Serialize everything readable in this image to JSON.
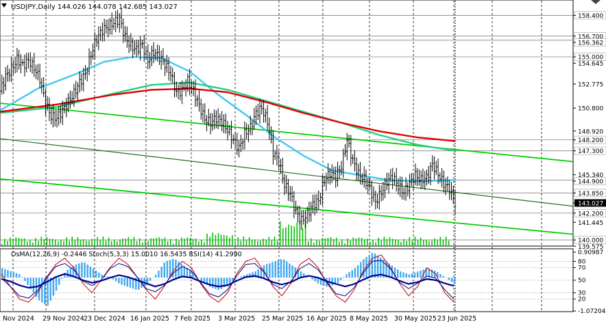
{
  "header": {
    "symbol_line": "USDJPY,Daily  144.026 144.078 142.685 143.027",
    "indicator_line": "OsMA(12,26,9) -0.2446  Stoch(5,3,3) 15.0010 16.5435  RSI(14) 41.2990"
  },
  "colors": {
    "price_bars": "#000000",
    "ma_fast": "#40c8f0",
    "ma_mid": "#20d080",
    "ma_slow": "#e00000",
    "channel": "#00d000",
    "channel_dark": "#207020",
    "volume": "#00c000",
    "osma_hist": "#40a8f0",
    "macd_line": "#00008b",
    "stoch_main": "#c00000",
    "stoch_signal": "#000080",
    "level_line": "#808080",
    "current_price_bg": "#000000"
  },
  "chart_data": [
    {
      "type": "candlestick",
      "title": "USDJPY,Daily  144.026 144.078 142.685 143.027",
      "y_ticks": [
        "158.400",
        "156.700",
        "156.362",
        "155.000",
        "154.645",
        "152.775",
        "150.800",
        "148.920",
        "148.200",
        "147.300",
        "145.340",
        "144.900",
        "143.850",
        "143.027",
        "142.200",
        "141.445",
        "140.000",
        "139.575"
      ],
      "ylim": [
        139.5,
        159.6
      ],
      "price_levels": [
        158.4,
        156.7,
        156.362,
        155.0,
        148.2,
        147.3,
        144.9,
        143.85,
        142.2,
        140.0
      ],
      "current_price": 143.027,
      "x_labels": [
        "7 Nov 2024",
        "29 Nov 2024",
        "23 Dec 2024",
        "16 Jan 2025",
        "7 Feb 2025",
        "3 Mar 2025",
        "25 Mar 2025",
        "16 Apr 2025",
        "8 May 2025",
        "30 May 2025",
        "23 Jun 2025"
      ],
      "close_path": [
        [
          0,
          152.2
        ],
        [
          3,
          153.4
        ],
        [
          6,
          154.0
        ],
        [
          9,
          154.8
        ],
        [
          12,
          154.3
        ],
        [
          15,
          154.7
        ],
        [
          18,
          154.1
        ],
        [
          21,
          153.2
        ],
        [
          24,
          151.2
        ],
        [
          27,
          150.1
        ],
        [
          30,
          150.0
        ],
        [
          33,
          150.6
        ],
        [
          36,
          151.3
        ],
        [
          39,
          152.0
        ],
        [
          42,
          152.9
        ],
        [
          45,
          153.6
        ],
        [
          48,
          155.2
        ],
        [
          51,
          156.5
        ],
        [
          54,
          157.2
        ],
        [
          57,
          157.5
        ],
        [
          60,
          157.8
        ],
        [
          63,
          158.1
        ],
        [
          66,
          156.6
        ],
        [
          69,
          155.9
        ],
        [
          72,
          155.6
        ],
        [
          75,
          156.0
        ],
        [
          78,
          154.7
        ],
        [
          81,
          155.4
        ],
        [
          84,
          155.0
        ],
        [
          87,
          154.4
        ],
        [
          90,
          153.6
        ],
        [
          93,
          152.1
        ],
        [
          96,
          152.2
        ],
        [
          99,
          153.0
        ],
        [
          102,
          152.2
        ],
        [
          105,
          151.0
        ],
        [
          108,
          149.9
        ],
        [
          111,
          149.6
        ],
        [
          114,
          150.0
        ],
        [
          117,
          149.7
        ],
        [
          120,
          149.0
        ],
        [
          123,
          148.2
        ],
        [
          126,
          147.5
        ],
        [
          129,
          148.7
        ],
        [
          132,
          149.2
        ],
        [
          135,
          150.4
        ],
        [
          138,
          150.8
        ],
        [
          141,
          149.7
        ],
        [
          144,
          147.2
        ],
        [
          147,
          146.4
        ],
        [
          150,
          144.5
        ],
        [
          153,
          143.8
        ],
        [
          156,
          142.3
        ],
        [
          159,
          141.6
        ],
        [
          162,
          142.1
        ],
        [
          165,
          142.9
        ],
        [
          168,
          143.2
        ],
        [
          171,
          144.9
        ],
        [
          174,
          145.5
        ],
        [
          177,
          145.2
        ],
        [
          180,
          146.0
        ],
        [
          183,
          148.2
        ],
        [
          186,
          146.5
        ],
        [
          189,
          145.4
        ],
        [
          192,
          145.0
        ],
        [
          195,
          144.2
        ],
        [
          198,
          143.1
        ],
        [
          201,
          143.9
        ],
        [
          204,
          144.8
        ],
        [
          207,
          145.2
        ],
        [
          210,
          144.4
        ],
        [
          213,
          143.9
        ],
        [
          216,
          144.6
        ],
        [
          219,
          145.3
        ],
        [
          222,
          144.9
        ],
        [
          225,
          145.1
        ],
        [
          228,
          146.2
        ],
        [
          231,
          145.4
        ],
        [
          234,
          144.6
        ],
        [
          237,
          144.2
        ],
        [
          240,
          143.0
        ]
      ],
      "moving_averages": [
        {
          "name": "ma_fast",
          "values": [
            [
              0,
              150.6
            ],
            [
              20,
              152.4
            ],
            [
              40,
              153.6
            ],
            [
              55,
              154.6
            ],
            [
              70,
              155.0
            ],
            [
              85,
              154.9
            ],
            [
              100,
              153.8
            ],
            [
              115,
              151.9
            ],
            [
              130,
              150.2
            ],
            [
              145,
              148.4
            ],
            [
              160,
              146.9
            ],
            [
              175,
              145.7
            ],
            [
              190,
              145.3
            ],
            [
              205,
              144.9
            ],
            [
              220,
              144.8
            ],
            [
              240,
              144.9
            ]
          ]
        },
        {
          "name": "ma_mid",
          "values": [
            [
              0,
              150.4
            ],
            [
              30,
              150.9
            ],
            [
              60,
              152.0
            ],
            [
              80,
              152.7
            ],
            [
              100,
              152.9
            ],
            [
              120,
              152.3
            ],
            [
              140,
              151.4
            ],
            [
              160,
              150.5
            ],
            [
              180,
              149.6
            ],
            [
              200,
              148.6
            ],
            [
              220,
              147.8
            ],
            [
              240,
              147.3
            ]
          ]
        },
        {
          "name": "ma_slow",
          "values": [
            [
              0,
              150.5
            ],
            [
              30,
              151.1
            ],
            [
              60,
              151.9
            ],
            [
              80,
              152.3
            ],
            [
              100,
              152.4
            ],
            [
              120,
              152.1
            ],
            [
              140,
              151.3
            ],
            [
              160,
              150.4
            ],
            [
              180,
              149.6
            ],
            [
              200,
              148.9
            ],
            [
              220,
              148.4
            ],
            [
              240,
              148.1
            ]
          ]
        }
      ],
      "channel_lines": [
        {
          "name": "channel_upper",
          "values": [
            [
              0,
              151.2
            ],
            [
              240,
              147.4
            ]
          ]
        },
        {
          "name": "channel_middle",
          "values": [
            [
              0,
              148.3
            ],
            [
              240,
              143.9
            ]
          ]
        },
        {
          "name": "channel_lower",
          "values": [
            [
              0,
              145.0
            ],
            [
              240,
              141.4
            ]
          ]
        }
      ]
    },
    {
      "type": "oscillator",
      "title": "OsMA(12,26,9) -0.2446  Stoch(5,3,3) 15.0010 16.5435  RSI(14) 41.2990",
      "y_ticks": [
        "0.90987",
        "80",
        "70",
        "50",
        "30",
        "20",
        "-1.07204"
      ],
      "ylim": [
        -1.07204,
        0.90987
      ],
      "levels": [
        80,
        70,
        50,
        30,
        20
      ],
      "osma": [
        0.3,
        0.2,
        0.1,
        -0.3,
        -0.7,
        -0.9,
        -0.4,
        0.2,
        0.4,
        0.5,
        0.3,
        0.1,
        0.0,
        -0.2,
        -0.3,
        -0.4,
        -0.2,
        0.1,
        0.5,
        0.6,
        0.4,
        0.2,
        -0.1,
        -0.3,
        -0.4,
        -0.2,
        0.0,
        0.1,
        0.2,
        0.4,
        0.5,
        0.6,
        0.4,
        0.2,
        0.0,
        -0.2,
        -0.3,
        -0.2,
        0.1,
        0.3,
        0.6,
        0.8,
        0.6,
        0.4,
        0.2,
        0.1,
        0.2,
        0.3,
        0.2,
        0.0,
        -0.2
      ],
      "stoch": [
        60,
        40,
        20,
        15,
        30,
        55,
        75,
        85,
        70,
        45,
        30,
        50,
        70,
        85,
        75,
        55,
        35,
        20,
        40,
        65,
        80,
        70,
        45,
        25,
        15,
        30,
        60,
        80,
        85,
        65,
        40,
        25,
        45,
        75,
        85,
        70,
        45,
        25,
        15,
        35,
        65,
        85,
        90,
        70,
        45,
        25,
        40,
        70,
        60,
        30,
        15
      ],
      "rsi": [
        52,
        48,
        42,
        38,
        40,
        47,
        55,
        60,
        56,
        50,
        46,
        49,
        54,
        58,
        55,
        50,
        45,
        40,
        44,
        51,
        56,
        54,
        48,
        43,
        40,
        42,
        49,
        55,
        57,
        53,
        47,
        43,
        47,
        54,
        57,
        54,
        48,
        44,
        40,
        44,
        51,
        57,
        59,
        55,
        49,
        44,
        47,
        52,
        50,
        45,
        41
      ]
    }
  ]
}
